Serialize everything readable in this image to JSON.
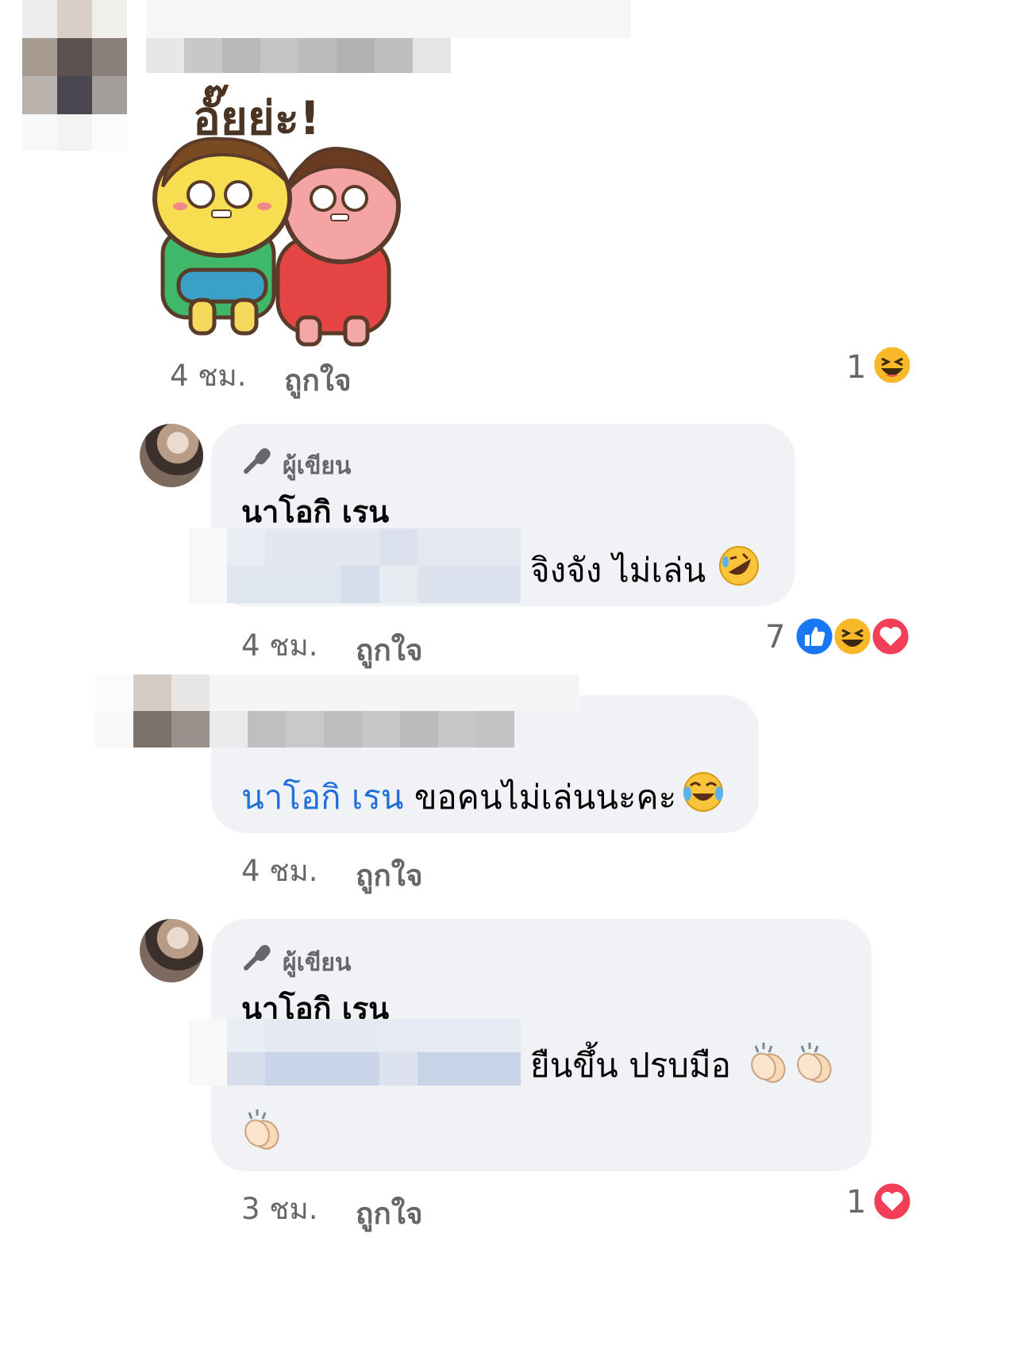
{
  "comment1": {
    "sticker_text": "อั๊ยย่ะ!",
    "time": "4 ชม.",
    "like_label": "ถูกใจ",
    "reaction_count": "1",
    "reactions": [
      "haha-icon"
    ]
  },
  "reply1": {
    "author_tag": "ผู้เขียน",
    "author_name": "นาโอกิ เรน",
    "text": "จิงจัง ไม่เล่น",
    "emoji": "rofl-emoji-icon",
    "time": "4 ชม.",
    "like_label": "ถูกใจ",
    "reaction_count": "7",
    "reactions": [
      "like-icon",
      "haha-icon",
      "love-icon"
    ]
  },
  "reply2": {
    "mention": "นาโอกิ เรน",
    "text": "ขอคนไม่เล่นนะคะ",
    "emoji": "tears-of-joy-emoji-icon",
    "time": "4 ชม.",
    "like_label": "ถูกใจ"
  },
  "reply3": {
    "author_tag": "ผู้เขียน",
    "author_name": "นาโอกิ เรน",
    "text": "ยืนขึ้น ปรบมือ",
    "emoji": "clapping-hands-emoji-icon",
    "time": "3 ชม.",
    "like_label": "ถูกใจ",
    "reaction_count": "1",
    "reactions": [
      "love-icon"
    ]
  },
  "colors": {
    "bubble": "#f0f2f5",
    "meta_text": "#65676b",
    "mention": "#216fdb",
    "like_blue": "#1877f2",
    "love_red": "#f33e58",
    "haha_yellow": "#f7b928"
  }
}
